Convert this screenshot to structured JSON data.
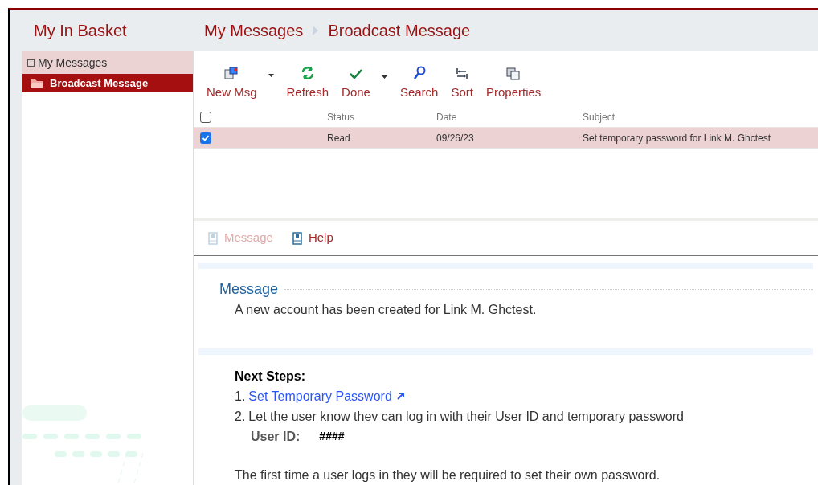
{
  "sidebar": {
    "title": "My In Basket",
    "tree": [
      {
        "label": "My Messages",
        "expanded": true,
        "selected": false,
        "children": [
          {
            "label": "Broadcast Message",
            "selected": true
          }
        ]
      }
    ]
  },
  "breadcrumb": [
    "My Messages",
    "Broadcast Message"
  ],
  "toolbar": [
    {
      "kind": "newmsg",
      "label": "New Msg",
      "has_menu": true
    },
    {
      "kind": "refresh",
      "label": "Refresh",
      "has_menu": false
    },
    {
      "kind": "done",
      "label": "Done",
      "has_menu": true
    },
    {
      "kind": "search",
      "label": "Search",
      "has_menu": false
    },
    {
      "kind": "sort",
      "label": "Sort",
      "has_menu": false
    },
    {
      "kind": "properties",
      "label": "Properties",
      "has_menu": false
    }
  ],
  "table": {
    "all_checked": false,
    "columns": [
      "Status",
      "Date",
      "Subject"
    ],
    "rows": [
      {
        "checked": true,
        "selected": true,
        "cells": [
          "Read",
          "09/26/23",
          "Set temporary password for Link M. Ghctest"
        ]
      }
    ]
  },
  "tabs": [
    {
      "label": "Message",
      "disabled": true
    },
    {
      "label": "Help",
      "disabled": false
    }
  ],
  "message": {
    "heading": "Message",
    "body": "A new account has been created for Link M. Ghctest.",
    "next_steps_title": "Next Steps:",
    "steps": [
      {
        "kind": "link",
        "number": "1.",
        "text": "Set Temporary Password"
      },
      {
        "kind": "text",
        "number": "2.",
        "text": "Let the user know thev can log in with their User ID and temporary password"
      }
    ],
    "user_id_label": "User ID:",
    "user_id_value": "####",
    "footer": "The first time a user logs in they will be required to set their own password."
  }
}
